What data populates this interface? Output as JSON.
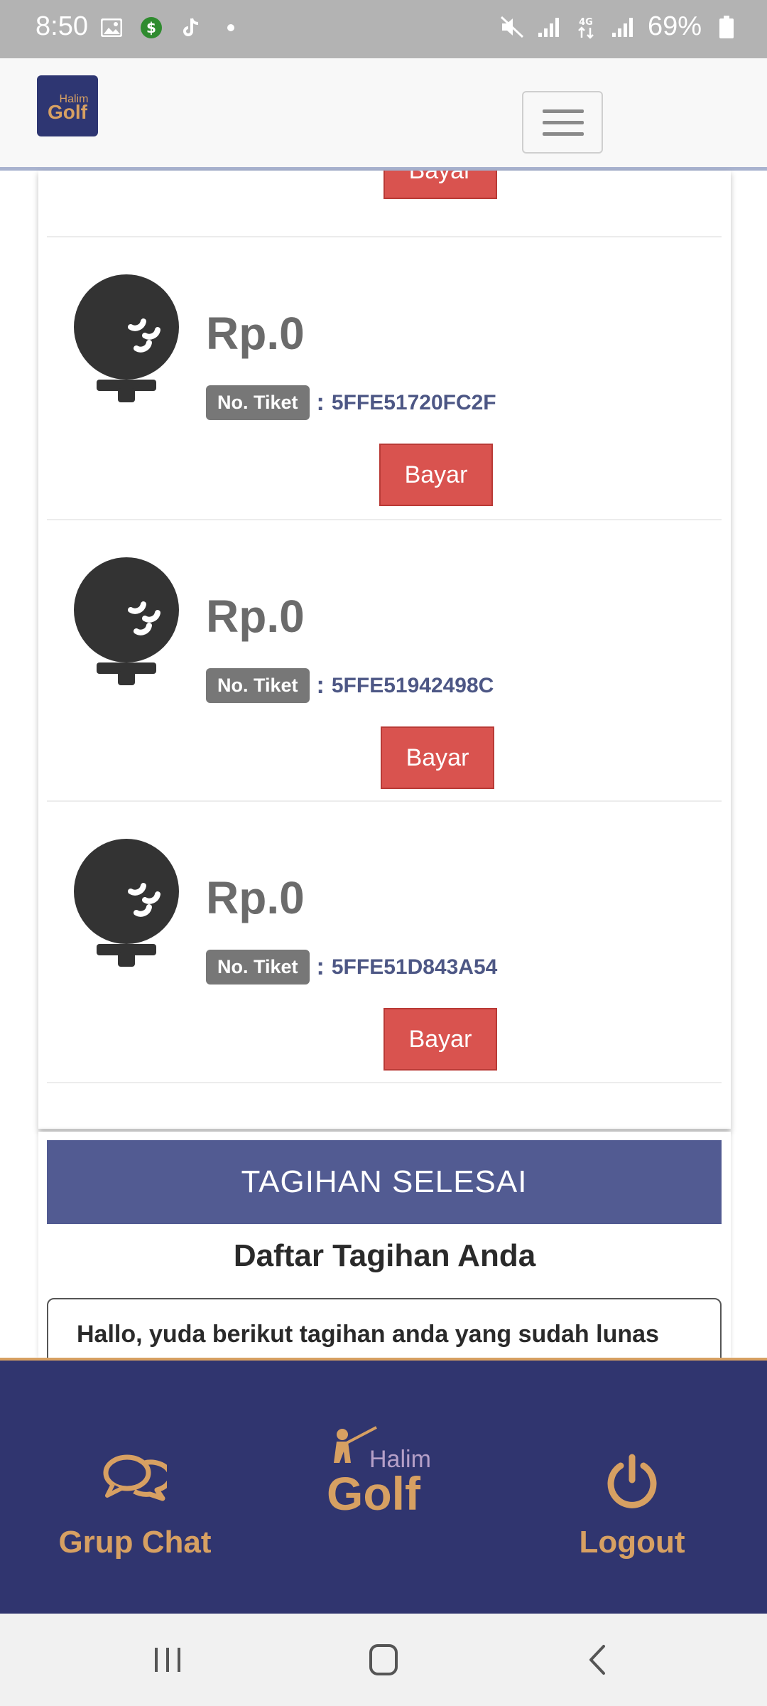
{
  "status_bar": {
    "time": "8:50",
    "battery": "69%",
    "icons": [
      "gallery-icon",
      "money-icon",
      "tiktok-icon",
      "dot-icon",
      "mute-icon",
      "signal-icon",
      "4g-icon",
      "signal-icon",
      "battery-icon"
    ]
  },
  "header": {
    "logo_top": "Halim",
    "logo_bottom": "Golf",
    "menu_icon": "hamburger-icon"
  },
  "tickets_partial": {
    "button_label": "Bayar"
  },
  "tickets": [
    {
      "price": "Rp.0",
      "ticket_label": "No. Tiket",
      "separator": ":",
      "ticket_code": "5FFE51720FC2F",
      "button_label": "Bayar"
    },
    {
      "price": "Rp.0",
      "ticket_label": "No. Tiket",
      "separator": ":",
      "ticket_code": "5FFE51942498C",
      "button_label": "Bayar"
    },
    {
      "price": "Rp.0",
      "ticket_label": "No. Tiket",
      "separator": ":",
      "ticket_code": "5FFE51D843A54",
      "button_label": "Bayar"
    }
  ],
  "completed": {
    "banner": "TAGIHAN SELESAI",
    "subtitle": "Daftar Tagihan Anda",
    "message": "Hallo, yuda berikut tagihan anda yang sudah lunas"
  },
  "bottom_nav": {
    "chat_label": "Grup Chat",
    "logo_top": "Halim",
    "logo_bottom": "Golf",
    "logout_label": "Logout"
  },
  "colors": {
    "accent": "#d7a062",
    "nav_bg": "#30356f",
    "banner_bg": "#525b92",
    "button_red": "#d9534f",
    "ticket_code": "#4d5785"
  }
}
